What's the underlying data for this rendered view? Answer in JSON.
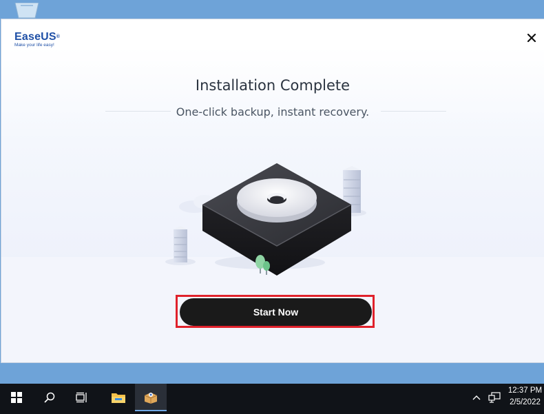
{
  "window": {
    "logo_brand": "EaseUS",
    "logo_reg": "®",
    "logo_tagline": "Make your life easy!",
    "close_glyph": "✕",
    "title": "Installation Complete",
    "subtitle": "One-click backup, instant recovery.",
    "start_button_label": "Start Now"
  },
  "taskbar": {
    "items": [
      {
        "icon": "windows-start-icon"
      },
      {
        "icon": "search-icon"
      },
      {
        "icon": "task-view-icon"
      },
      {
        "icon": "file-explorer-icon"
      },
      {
        "icon": "easeus-installer-icon",
        "active": true
      }
    ],
    "clock_time": "12:37 PM",
    "clock_date": "2/5/2022"
  },
  "colors": {
    "brand": "#1e4fa6",
    "button": "#1a1a1a",
    "highlight": "#e0212b",
    "desktop": "#6ea3d8",
    "taskbar": "#101318"
  }
}
